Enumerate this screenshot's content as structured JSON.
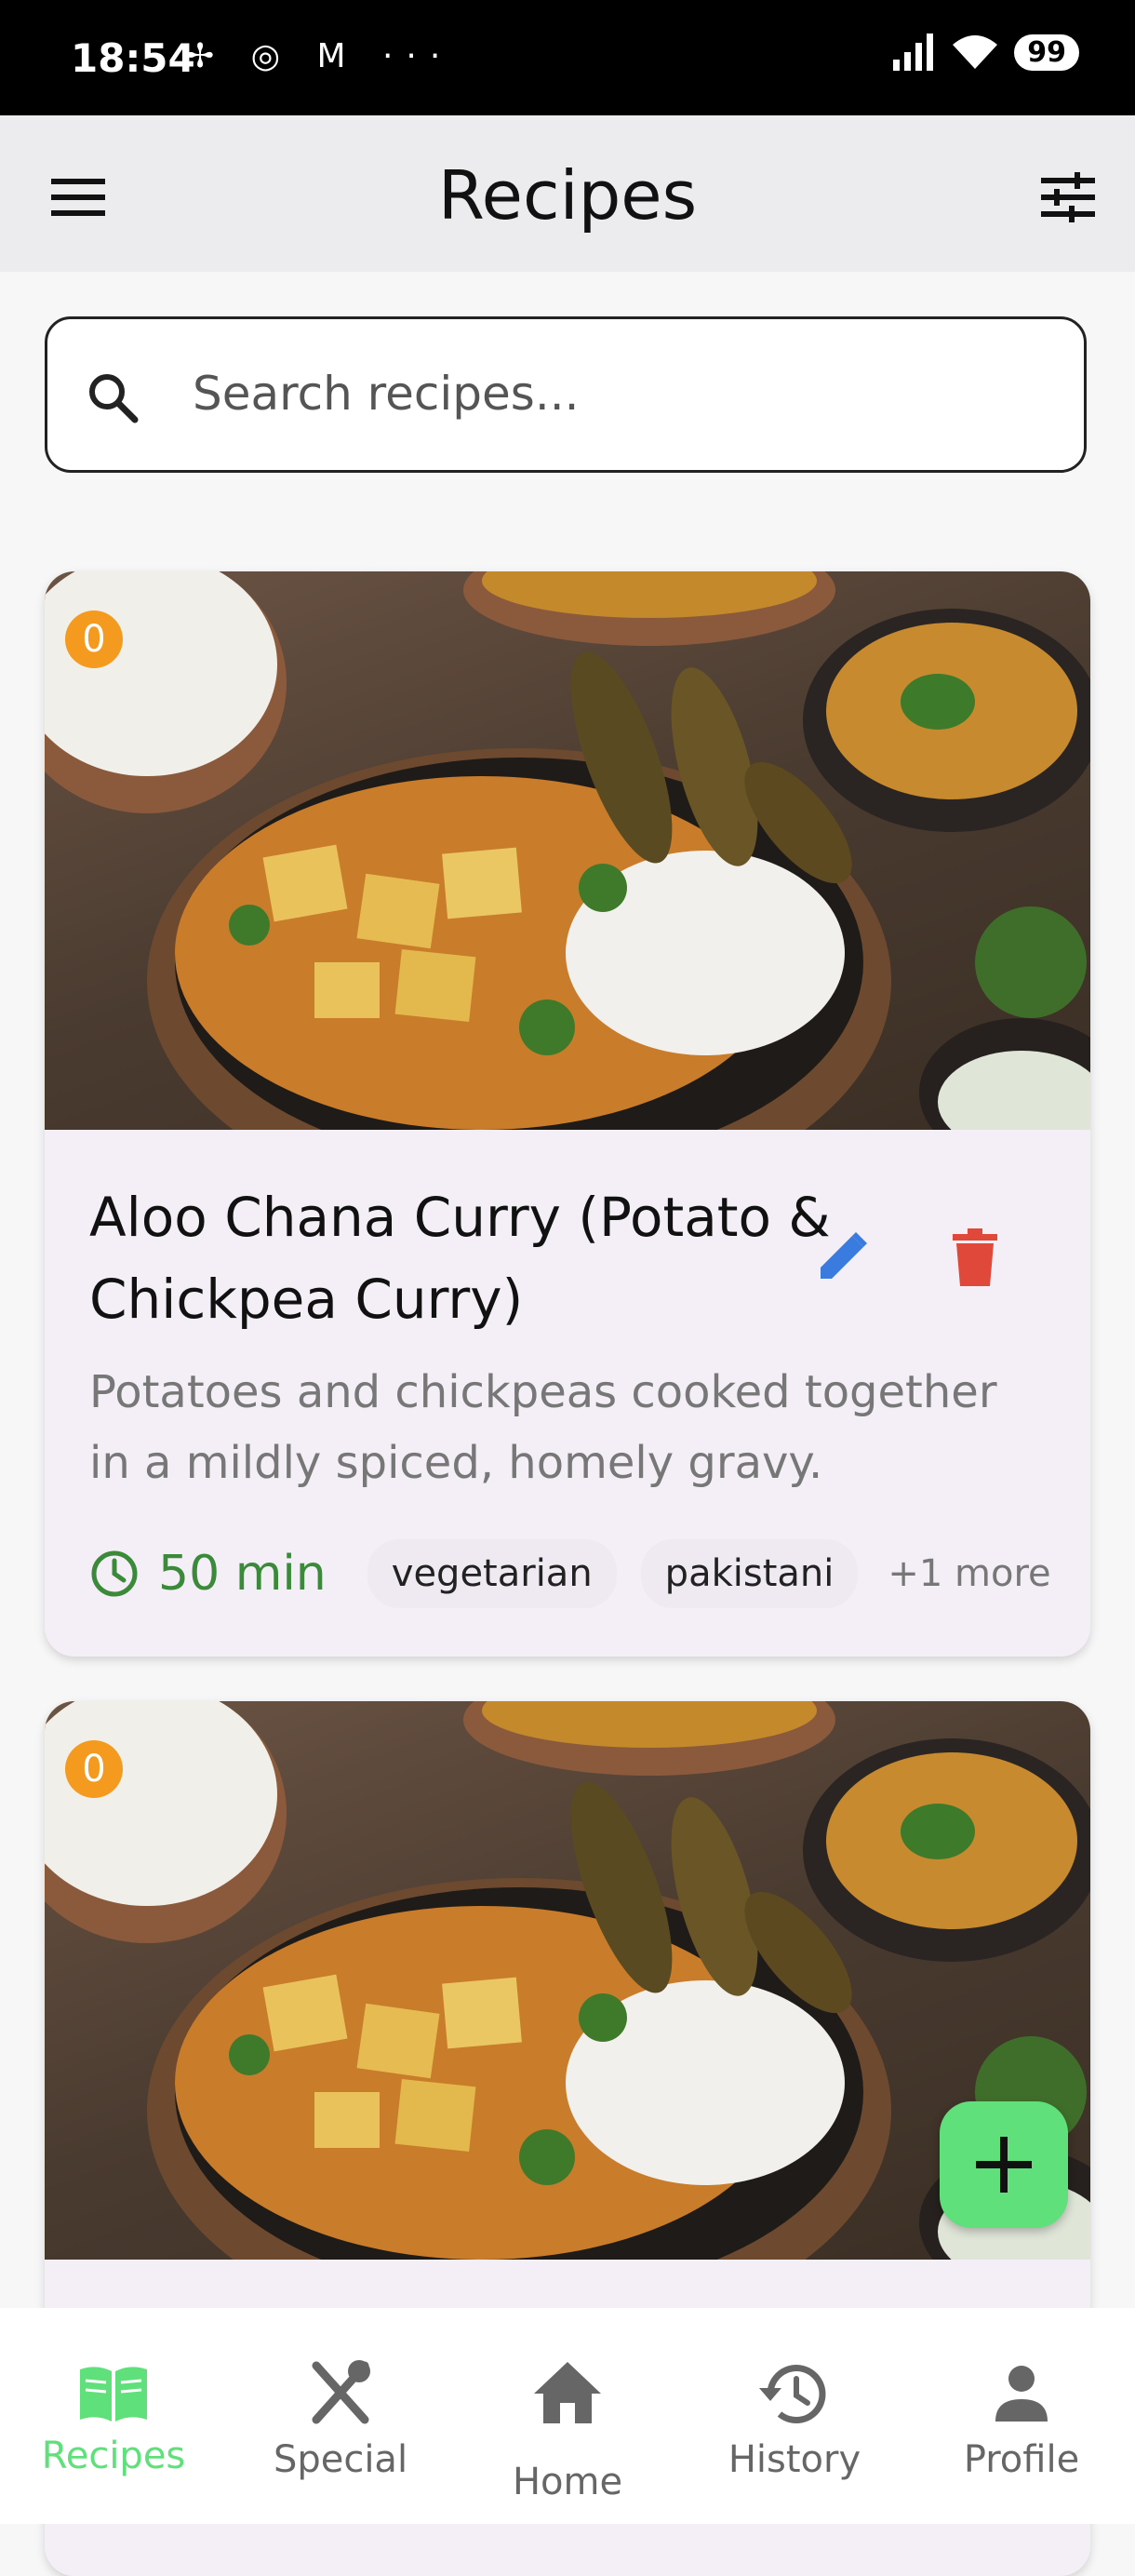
{
  "status_bar": {
    "time": "18:54",
    "icons": "✢ ◎ M ···",
    "battery": "99"
  },
  "app_bar": {
    "title": "Recipes",
    "menu_icon": "menu-icon",
    "filter_icon": "tune-icon"
  },
  "search": {
    "placeholder": "Search recipes..."
  },
  "recipes": [
    {
      "badge": "0",
      "title": "Aloo Chana Curry (Potato & Chickpea Curry)",
      "description": "Potatoes and chickpeas cooked together in a mildly spiced, homely gravy.",
      "time": "50 min",
      "tags": [
        "vegetarian",
        "pakistani"
      ],
      "more": "+1 more"
    },
    {
      "badge": "0"
    }
  ],
  "colors": {
    "accent_green": "#5fe07b",
    "edit_blue": "#3a7be0",
    "delete_red": "#e0483a",
    "badge_orange": "#f39a1f"
  },
  "bottom_nav": [
    {
      "label": "Recipes",
      "icon": "book-icon",
      "active": true
    },
    {
      "label": "Special",
      "icon": "utensils-icon"
    },
    {
      "label": "Home",
      "icon": "home-icon"
    },
    {
      "label": "History",
      "icon": "history-icon"
    },
    {
      "label": "Profile",
      "icon": "person-icon"
    }
  ]
}
